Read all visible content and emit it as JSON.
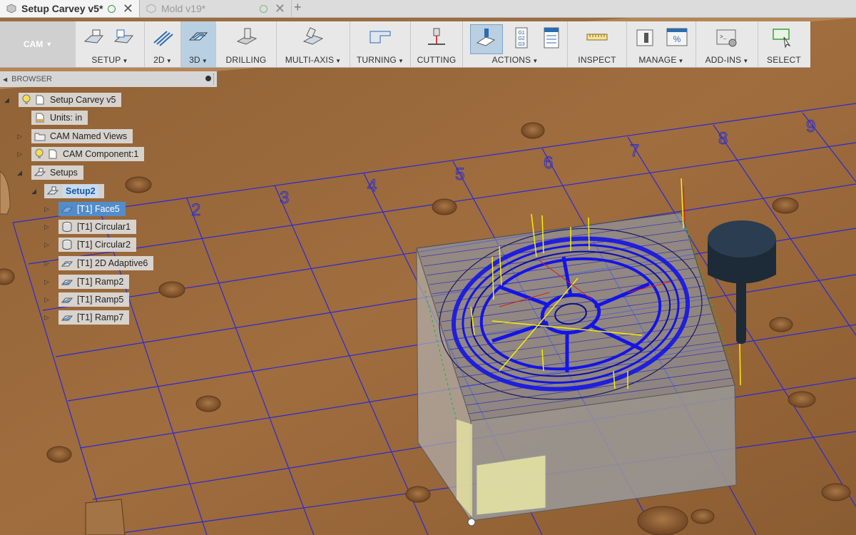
{
  "tabs": [
    {
      "label": "Setup Carvey v5*",
      "active": true
    },
    {
      "label": "Mold v19*",
      "active": false
    }
  ],
  "toolbar": {
    "workspace": "CAM",
    "groups": [
      {
        "label": "SETUP",
        "dropdown": true
      },
      {
        "label": "2D",
        "dropdown": true
      },
      {
        "label": "3D",
        "dropdown": true
      },
      {
        "label": "DRILLING",
        "dropdown": false
      },
      {
        "label": "MULTI-AXIS",
        "dropdown": true
      },
      {
        "label": "TURNING",
        "dropdown": true
      },
      {
        "label": "CUTTING",
        "dropdown": false
      },
      {
        "label": "ACTIONS",
        "dropdown": true
      },
      {
        "label": "INSPECT",
        "dropdown": false
      },
      {
        "label": "MANAGE",
        "dropdown": true
      },
      {
        "label": "ADD-INS",
        "dropdown": true
      },
      {
        "label": "SELECT",
        "dropdown": false
      }
    ],
    "caret": "▼",
    "actions_icon_text": [
      "G1",
      "G2",
      "G3"
    ]
  },
  "browser": {
    "title": "BROWSER",
    "root": "Setup Carvey v5",
    "units": "Units: in",
    "named_views": "CAM Named Views",
    "component": "CAM Component:1",
    "setups": "Setups",
    "setup2": "Setup2",
    "operations": [
      "[T1] Face5",
      "[T1] Circular1",
      "[T1] Circular2",
      "[T1] 2D Adaptive6",
      "[T1] Ramp2",
      "[T1] Ramp5",
      "[T1] Ramp7"
    ]
  },
  "grid_labels": [
    "2",
    "3",
    "4",
    "5",
    "6",
    "7",
    "8",
    "9"
  ],
  "colors": {
    "bed": "#9a6a3c",
    "grid": "#2a2ad8",
    "toolpath": "#1414e6",
    "rapid": "#f5f000",
    "highlight": "#4f8fd1"
  }
}
